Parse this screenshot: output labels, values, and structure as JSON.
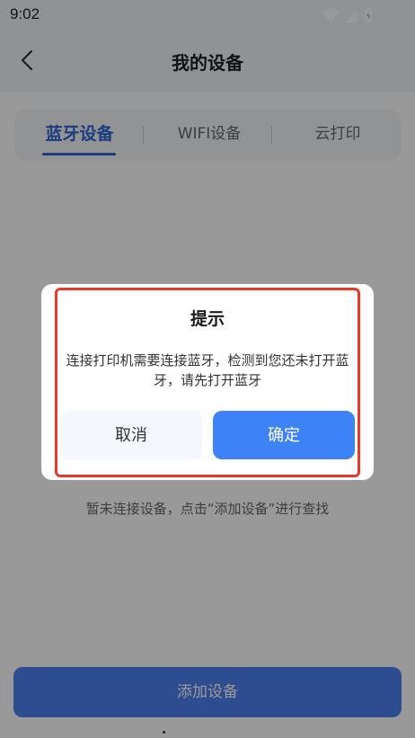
{
  "status_bar": {
    "time": "9:02",
    "icons": [
      "wifi-icon",
      "signal-icon",
      "battery-icon"
    ]
  },
  "header": {
    "title": "我的设备",
    "back_icon": "chevron-left-icon"
  },
  "tabs": [
    {
      "label": "蓝牙设备",
      "active": true
    },
    {
      "label": "WIFI设备",
      "active": false
    },
    {
      "label": "云打印",
      "active": false
    }
  ],
  "empty_hint": "暂未连接设备，点击“添加设备”进行查找",
  "add_button": {
    "label": "添加设备"
  },
  "dialog": {
    "title": "提示",
    "message": "连接打印机需要连接蓝牙，检测到您还未打开蓝牙，请先打开蓝牙",
    "cancel_label": "取消",
    "confirm_label": "确定"
  },
  "colors": {
    "accent": "#2f64d6",
    "confirm": "#3e82f7",
    "highlight": "#e53a2a"
  }
}
